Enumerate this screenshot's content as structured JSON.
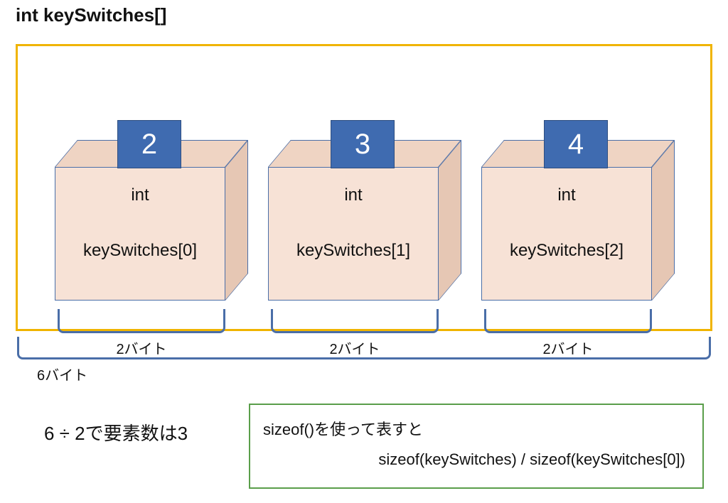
{
  "title": "int keySwitches[]",
  "boxes": [
    {
      "badge": "2",
      "type": "int",
      "name": "keySwitches[0]",
      "bytes": "2バイト"
    },
    {
      "badge": "3",
      "type": "int",
      "name": "keySwitches[1]",
      "bytes": "2バイト"
    },
    {
      "badge": "4",
      "type": "int",
      "name": "keySwitches[2]",
      "bytes": "2バイト"
    }
  ],
  "total_bytes": "6バイト",
  "conclusion": "6 ÷ 2で要素数は3",
  "sizeof": {
    "line1": "sizeof()を使って表すと",
    "line2": "sizeof(keySwitches) / sizeof(keySwitches[0])"
  },
  "colors": {
    "outer_border": "#f0b400",
    "cube_edge": "#4a6ea8",
    "cube_fill": "#f7e2d6",
    "badge_fill": "#3f6bb0",
    "sizeof_border": "#5a9e4a"
  }
}
